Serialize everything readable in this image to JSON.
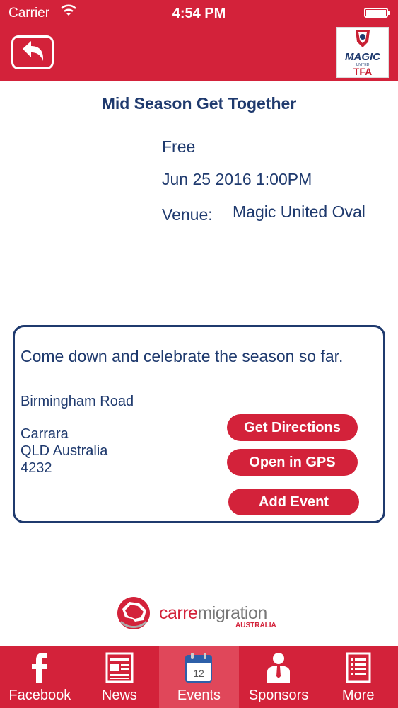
{
  "status_bar": {
    "carrier": "Carrier",
    "time": "4:54 PM"
  },
  "header": {
    "logo_line1": "MAGIC",
    "logo_line2": "UNITED",
    "logo_line3": "TFA"
  },
  "event": {
    "title": "Mid Season Get Together",
    "price": "Free",
    "datetime": "Jun 25 2016  1:00PM",
    "venue_label": "Venue:",
    "venue_value": "Magic United Oval"
  },
  "details": {
    "description": "Come down and celebrate the season so far.",
    "street": "Birmingham Road",
    "suburb": "Carrara",
    "state_country": "QLD Australia",
    "postcode": "4232",
    "buttons": {
      "directions": "Get Directions",
      "gps": "Open in GPS",
      "add_event": "Add Event"
    }
  },
  "sponsor": {
    "name_part1": "carre",
    "name_part2": "migration",
    "sub": "AUSTRALIA"
  },
  "tabs": [
    {
      "label": "Facebook",
      "icon": "facebook-icon"
    },
    {
      "label": "News",
      "icon": "news-icon"
    },
    {
      "label": "Events",
      "icon": "calendar-icon",
      "badge": "12",
      "active": true
    },
    {
      "label": "Sponsors",
      "icon": "person-icon"
    },
    {
      "label": "More",
      "icon": "list-icon"
    }
  ],
  "colors": {
    "brand_red": "#d3223a",
    "navy": "#1f3a6e",
    "active_tab": "#e0475a"
  }
}
